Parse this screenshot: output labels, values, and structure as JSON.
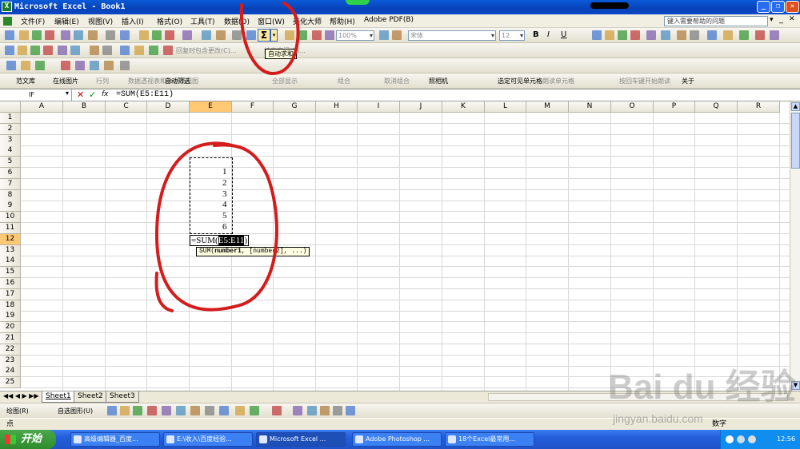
{
  "title": "Microsoft Excel - Book1",
  "menu": [
    "文件(F)",
    "编辑(E)",
    "视图(V)",
    "插入(I)",
    "格式(O)",
    "工具(T)",
    "数据(D)",
    "窗口(W)",
    "美化大师",
    "帮助(H)",
    "Adobe PDF(B)"
  ],
  "help_placeholder": "键入需要帮助的问题",
  "toolbar": {
    "zoom": "100%",
    "font": "宋体",
    "size": "12",
    "reply_text": "回复时包含更改(C)...",
    "end_review": "结束审阅(N)..."
  },
  "tooltip": "自动求和",
  "addin_bar": [
    "范文库",
    "在线图片",
    "行列",
    "数据透视表和数据透视图",
    "自动筛选",
    "全部显示",
    "组合",
    "取消组合",
    "照相机",
    "选定可见单元格",
    "朗读单元格",
    "按回车键开始朗读",
    "关于"
  ],
  "name_box": "IF",
  "formula": "=SUM(E5:E11)",
  "columns": [
    "A",
    "B",
    "C",
    "D",
    "E",
    "F",
    "G",
    "H",
    "I",
    "J",
    "K",
    "L",
    "M",
    "N",
    "O",
    "P",
    "Q",
    "R"
  ],
  "rows": [
    "1",
    "2",
    "3",
    "4",
    "5",
    "6",
    "7",
    "8",
    "9",
    "10",
    "11",
    "12",
    "13",
    "14",
    "15",
    "16",
    "17",
    "18",
    "19",
    "20",
    "21",
    "22",
    "23",
    "24",
    "25"
  ],
  "cells": [
    {
      "ref": "E6",
      "value": "1"
    },
    {
      "ref": "E7",
      "value": "2"
    },
    {
      "ref": "E8",
      "value": "3"
    },
    {
      "ref": "E9",
      "value": "4"
    },
    {
      "ref": "E10",
      "value": "5"
    },
    {
      "ref": "E11",
      "value": "6"
    }
  ],
  "edit_cell": {
    "ref": "E12",
    "prefix": "=SUM(",
    "range": "E5:E11",
    "suffix": ")"
  },
  "fn_hint": {
    "name": "SUM",
    "arg1": "number1",
    "rest": ", [number2], ...)"
  },
  "sheets": [
    "Sheet1",
    "Sheet2",
    "Sheet3"
  ],
  "drawbar": {
    "draw": "绘图(R)",
    "autoshape": "自选图形(U)"
  },
  "status": {
    "mode": "点",
    "num": "数字"
  },
  "taskbar": {
    "start": "开始",
    "tasks": [
      "高级编辑器_百度...",
      "E:\\收入\\百度经验...",
      "Microsoft Excel ...",
      "Adobe Photoshop ...",
      "18个Excel最常用..."
    ],
    "clock": "12:56"
  },
  "watermark": {
    "brand": "Bai du 经验",
    "url": "jingyan.baidu.com"
  }
}
